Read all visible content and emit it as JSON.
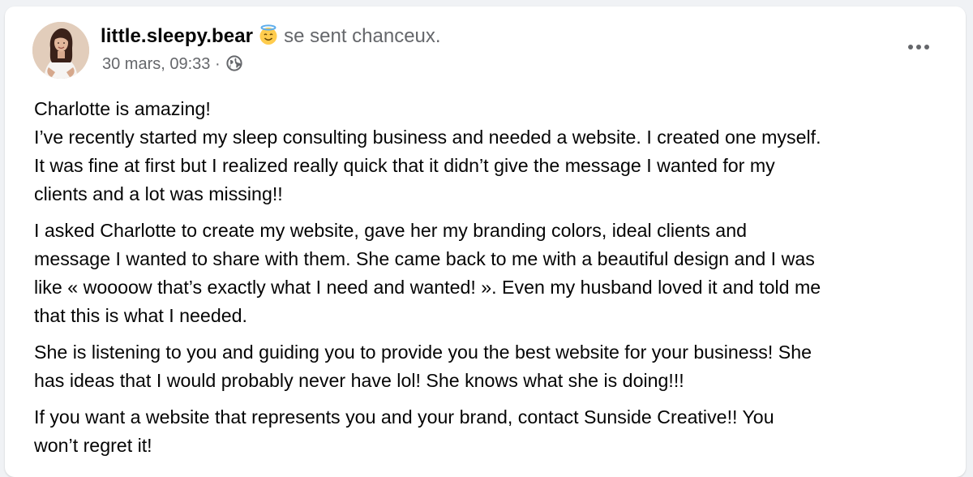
{
  "post": {
    "author": "little.sleepy.bear",
    "feeling_emoji": "smiling-face-with-halo",
    "feeling_text": "se sent chanceux.",
    "timestamp": "30 mars, 09:33",
    "separator": "·",
    "audience_icon": "globe-icon",
    "more_icon": "more-horizontal-icon",
    "paragraphs": [
      [
        "Charlotte is amazing!",
        "I’ve recently started my sleep consulting business and needed a website. I created one myself.",
        "It was fine at first but I realized really quick that it didn’t give the message I wanted for my",
        "clients and a lot was missing!!"
      ],
      [
        "I asked Charlotte to create my website, gave her my branding colors, ideal clients and",
        "message I wanted to share with them. She came back to me with a beautiful design and I was",
        "like « woooow that’s exactly what I need and wanted! ». Even my husband loved it and told me",
        "that this is what I needed."
      ],
      [
        "She is listening to you and guiding you to provide you the best website for your business! She",
        "has ideas that I would probably never have lol! She knows what she is doing!!!"
      ],
      [
        "If you want a website that represents you and your brand, contact Sunside Creative!! You",
        "won’t regret it!"
      ]
    ]
  },
  "colors": {
    "page_bg": "#f0f2f5",
    "card_bg": "#ffffff",
    "text_primary": "#050505",
    "text_secondary": "#65676b"
  }
}
